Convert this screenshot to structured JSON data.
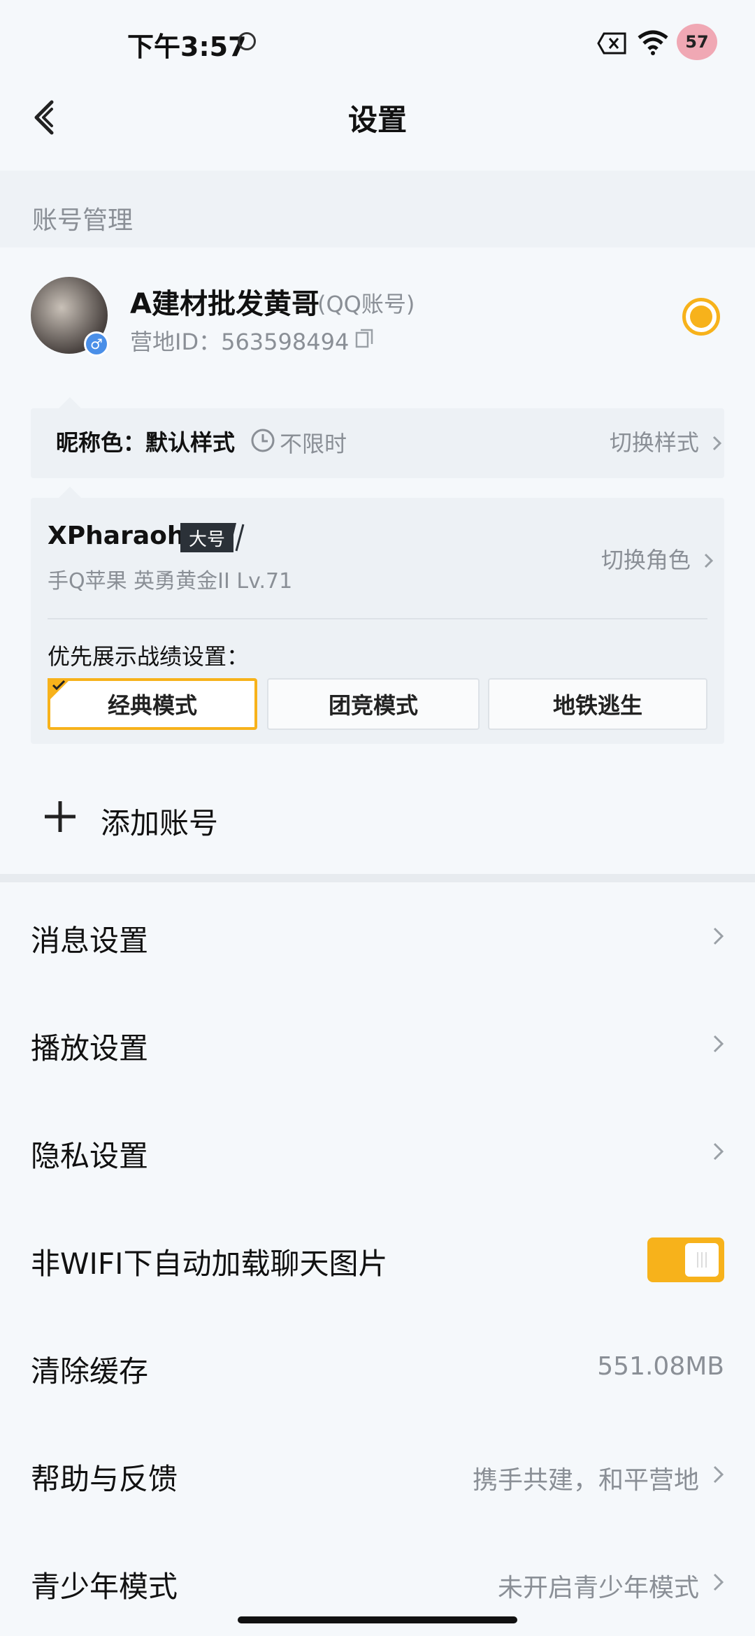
{
  "status_bar": {
    "time": "下午3:57",
    "battery": "57"
  },
  "header": {
    "title": "设置"
  },
  "account_section": {
    "label": "账号管理",
    "account": {
      "name": "A建材批发黄哥",
      "type": "(QQ账号)",
      "id_text": "营地ID：563598494",
      "selected": true
    },
    "nickname_color": {
      "label": "昵称色：默认样式",
      "duration": "不限时",
      "switch_label": "切换样式"
    },
    "role": {
      "name": "XPharaohX",
      "badge": "大号",
      "subtitle": "手Q苹果   英勇黄金II   Lv.71",
      "switch_label": "切换角色",
      "preference_label": "优先展示战绩设置：",
      "modes": [
        {
          "label": "经典模式",
          "active": true
        },
        {
          "label": "团竞模式",
          "active": false
        },
        {
          "label": "地铁逃生",
          "active": false
        }
      ]
    },
    "add_account": "添加账号"
  },
  "settings": {
    "message": "消息设置",
    "playback": "播放设置",
    "privacy": "隐私设置",
    "auto_load": "非WIFI下自动加载聊天图片",
    "auto_load_on": true,
    "clear_cache": "清除缓存",
    "cache_size": "551.08MB",
    "help": "帮助与反馈",
    "help_value": "携手共建，和平营地",
    "teen": "青少年模式",
    "teen_value": "未开启青少年模式"
  },
  "colors": {
    "accent": "#f7b21b",
    "secondary_text": "#8a8f96"
  }
}
